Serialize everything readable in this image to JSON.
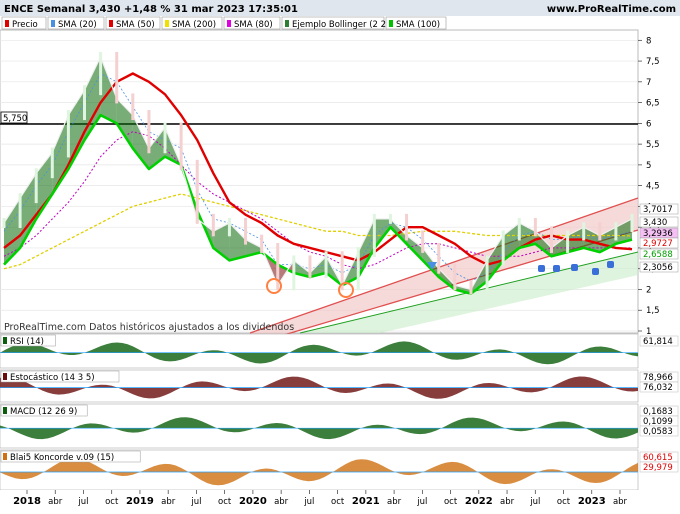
{
  "header": {
    "title": "ENCE Semanal 3,430 +1,48 % 31 mar 2023 17:35:01",
    "site": "www.ProRealTime.com"
  },
  "legend": [
    {
      "label": "Precio",
      "color": "#e00000"
    },
    {
      "label": "SMA (20)",
      "color": "#4a90e2"
    },
    {
      "label": "SMA (50)",
      "color": "#e00000"
    },
    {
      "label": "SMA (200)",
      "color": "#f0e000"
    },
    {
      "label": "SMA (80)",
      "color": "#e000e0"
    },
    {
      "label": "Ejemplo Bollinger (2 20)",
      "color": "#2e7d32"
    },
    {
      "label": "SMA (100)",
      "color": "#00c000"
    }
  ],
  "watermark": "ProRealTime.com  Datos históricos ajustados a los dividendos",
  "hline_label": "5,750",
  "colors": {
    "up": "#00e000",
    "down": "#e00000",
    "sma200": "#e0d000",
    "cloud_up": "#0a6a0a",
    "cloud_down": "#7a1010",
    "channel": "#e05050",
    "channel_fill": "#f2c9c9",
    "channel2": "#20a020",
    "magenta": "#c000c0"
  },
  "chart_data": {
    "type": "line",
    "title": "ENCE Semanal",
    "x_labels": [
      "2018",
      "abr",
      "jul",
      "oct",
      "2019",
      "abr",
      "jul",
      "oct",
      "2020",
      "abr",
      "jul",
      "oct",
      "2021",
      "abr",
      "jul",
      "oct",
      "2022",
      "abr",
      "jul",
      "oct",
      "2023",
      "abr"
    ],
    "y_ticks": [
      "8",
      "7,5",
      "7",
      "6,5",
      "6",
      "5,5",
      "5",
      "4,5",
      "4",
      "3,5",
      "3",
      "2,5",
      "2",
      "1,5",
      "1"
    ],
    "ylim": [
      1,
      8.2
    ],
    "price_labels": [
      {
        "text": "3,7017",
        "bg": "#ffffff",
        "fg": "#000000"
      },
      {
        "text": "3,430",
        "bg": "#ffffff",
        "fg": "#000000"
      },
      {
        "text": "3,2936",
        "bg": "#f4c0f4",
        "fg": "#000000"
      },
      {
        "text": "2,9727",
        "bg": "#ffffff",
        "fg": "#e00000"
      },
      {
        "text": "2,6588",
        "bg": "#ffffff",
        "fg": "#00a000"
      },
      {
        "text": "2,3056",
        "bg": "#ffffff",
        "fg": "#000000"
      }
    ],
    "series": [
      {
        "name": "Precio",
        "values": [
          3.6,
          4.2,
          4.8,
          5.3,
          6.2,
          6.8,
          7.6,
          6.6,
          6.2,
          5.4,
          5.9,
          5.0,
          3.7,
          3.4,
          3.6,
          3.2,
          3.0,
          2.1,
          2.7,
          2.4,
          2.8,
          2.1,
          2.9,
          3.7,
          3.7,
          3.3,
          3.0,
          2.5,
          2.1,
          2.0,
          2.7,
          3.3,
          3.6,
          3.4,
          3.0,
          3.3,
          3.5,
          3.3,
          3.5,
          3.7
        ]
      },
      {
        "name": "SMA (20)",
        "values": [
          3.4,
          3.9,
          4.5,
          5.0,
          5.8,
          6.5,
          7.2,
          7.0,
          6.4,
          5.8,
          5.6,
          5.4,
          4.4,
          3.7,
          3.6,
          3.4,
          3.2,
          2.6,
          2.6,
          2.5,
          2.6,
          2.4,
          2.6,
          3.3,
          3.6,
          3.5,
          3.2,
          2.8,
          2.4,
          2.2,
          2.4,
          2.9,
          3.3,
          3.4,
          3.2,
          3.2,
          3.3,
          3.2,
          3.3,
          3.4
        ]
      },
      {
        "name": "SMA (50)",
        "values": [
          3.0,
          3.3,
          3.8,
          4.3,
          5.0,
          5.8,
          6.5,
          7.0,
          7.2,
          7.0,
          6.7,
          6.2,
          5.6,
          4.8,
          4.1,
          3.8,
          3.6,
          3.3,
          3.1,
          3.0,
          2.9,
          2.8,
          2.7,
          2.9,
          3.2,
          3.5,
          3.5,
          3.3,
          3.1,
          2.8,
          2.6,
          2.7,
          3.0,
          3.2,
          3.3,
          3.2,
          3.2,
          3.1,
          3.0,
          2.97
        ]
      },
      {
        "name": "SMA (200)",
        "values": [
          2.5,
          2.6,
          2.8,
          3.0,
          3.2,
          3.4,
          3.6,
          3.8,
          4.0,
          4.1,
          4.2,
          4.3,
          4.2,
          4.1,
          4.0,
          3.9,
          3.8,
          3.7,
          3.6,
          3.5,
          3.4,
          3.4,
          3.3,
          3.3,
          3.3,
          3.35,
          3.4,
          3.4,
          3.4,
          3.35,
          3.3,
          3.3,
          3.3,
          3.3,
          3.3,
          3.3,
          3.3,
          3.3,
          3.3,
          3.29
        ]
      },
      {
        "name": "SMA (80)",
        "values": [
          2.8,
          3.0,
          3.3,
          3.7,
          4.1,
          4.6,
          5.2,
          5.6,
          5.8,
          5.7,
          5.4,
          5.0,
          4.6,
          4.3,
          4.1,
          3.9,
          3.7,
          3.4,
          3.1,
          2.9,
          2.8,
          2.6,
          2.5,
          2.6,
          2.8,
          3.0,
          3.1,
          3.1,
          3.0,
          2.9,
          2.8,
          2.8,
          2.8,
          2.9,
          3.0,
          3.0,
          3.0,
          3.0,
          3.0,
          3.0
        ]
      },
      {
        "name": "SMA (100)",
        "values": [
          2.6,
          3.0,
          3.7,
          4.3,
          4.9,
          5.6,
          6.2,
          6.0,
          5.4,
          4.9,
          5.2,
          5.0,
          3.9,
          3.0,
          2.7,
          2.8,
          2.9,
          2.6,
          2.4,
          2.3,
          2.4,
          2.1,
          2.3,
          3.0,
          3.5,
          3.1,
          2.7,
          2.3,
          2.0,
          1.9,
          2.2,
          2.7,
          3.0,
          3.1,
          2.8,
          2.9,
          3.0,
          2.9,
          3.1,
          3.2
        ]
      }
    ]
  },
  "panels": [
    {
      "label": "RSI (14)",
      "values": [
        "61,814"
      ]
    },
    {
      "label": "Estocástico (14 3 5)",
      "values": [
        "78,966",
        "76,032"
      ]
    },
    {
      "label": "MACD (12 26 9)",
      "values": [
        "0,1683",
        "0,1099",
        "0,0583"
      ]
    },
    {
      "label": "Blai5 Koncorde v.09 (15)",
      "values": [
        "60,615",
        "29,979"
      ]
    }
  ]
}
